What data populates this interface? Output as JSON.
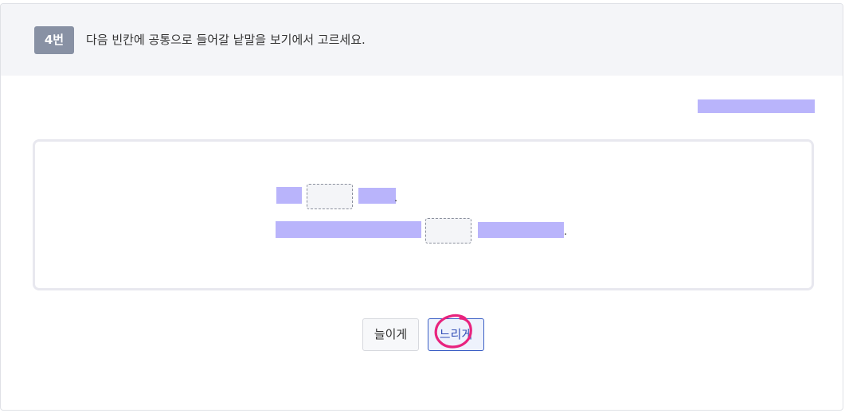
{
  "question": {
    "number": "4번",
    "prompt": "다음 빈칸에 공통으로 들어갈 낱말을 보기에서 고르세요."
  },
  "passage": {
    "line1_end": ".",
    "line2_end": "."
  },
  "choices": [
    {
      "label": "늘이게"
    },
    {
      "label": "느리게"
    }
  ],
  "colors": {
    "header_bg": "#f4f5f8",
    "badge_bg": "#8891a4",
    "redaction": "#b9b4fb",
    "selected_border": "#3b5fc5",
    "annotation": "#e8237e"
  }
}
